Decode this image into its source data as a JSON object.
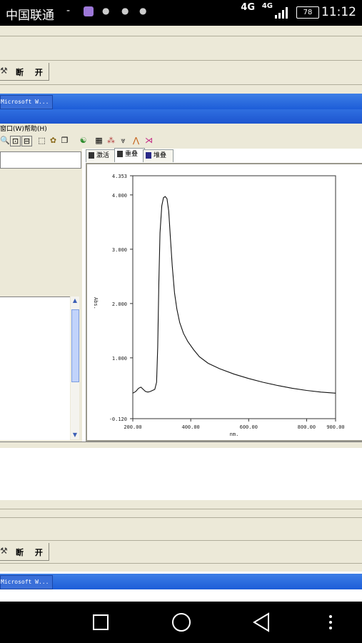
{
  "status_bar": {
    "carrier": "中国联通",
    "separator": "-",
    "network1": "4G",
    "network2": "4G",
    "battery": "78",
    "time": "11:12"
  },
  "top_window": {
    "disconnect_label": "断 开",
    "taskbar_item": "Microsoft W..."
  },
  "main_window": {
    "menu": [
      "窗口(W)",
      "帮助(H)"
    ],
    "tabs": [
      {
        "label": "激活"
      },
      {
        "label": "重叠"
      },
      {
        "label": "堆叠"
      }
    ]
  },
  "bottom_window": {
    "disconnect_label": "断 开",
    "taskbar_item": "Microsoft W..."
  },
  "chart_data": {
    "type": "line",
    "ylabel": "Abs.",
    "xlabel": "nm.",
    "xlim": [
      200.0,
      900.0
    ],
    "ylim": [
      -0.12,
      4.353
    ],
    "x_ticks": [
      "200.00",
      "400.00",
      "600.00",
      "800.00",
      "900.00"
    ],
    "y_ticks": [
      "4.353",
      "4.000",
      "3.000",
      "2.000",
      "1.000",
      "-0.120"
    ],
    "series": [
      {
        "points": [
          [
            200,
            0.35
          ],
          [
            210,
            0.38
          ],
          [
            220,
            0.44
          ],
          [
            228,
            0.46
          ],
          [
            236,
            0.42
          ],
          [
            244,
            0.38
          ],
          [
            252,
            0.37
          ],
          [
            260,
            0.38
          ],
          [
            268,
            0.4
          ],
          [
            276,
            0.42
          ],
          [
            282,
            0.55
          ],
          [
            286,
            1.2
          ],
          [
            290,
            2.4
          ],
          [
            294,
            3.3
          ],
          [
            300,
            3.8
          ],
          [
            306,
            3.95
          ],
          [
            312,
            3.97
          ],
          [
            318,
            3.93
          ],
          [
            324,
            3.7
          ],
          [
            330,
            3.2
          ],
          [
            336,
            2.7
          ],
          [
            344,
            2.2
          ],
          [
            352,
            1.9
          ],
          [
            362,
            1.65
          ],
          [
            375,
            1.45
          ],
          [
            390,
            1.3
          ],
          [
            410,
            1.15
          ],
          [
            430,
            1.02
          ],
          [
            460,
            0.9
          ],
          [
            500,
            0.8
          ],
          [
            550,
            0.7
          ],
          [
            600,
            0.62
          ],
          [
            650,
            0.55
          ],
          [
            700,
            0.49
          ],
          [
            750,
            0.44
          ],
          [
            800,
            0.4
          ],
          [
            850,
            0.37
          ],
          [
            900,
            0.35
          ]
        ]
      }
    ]
  },
  "nav": {
    "icons": [
      "square-icon",
      "circle-icon",
      "back-triangle-icon",
      "menu-dots-icon"
    ]
  }
}
